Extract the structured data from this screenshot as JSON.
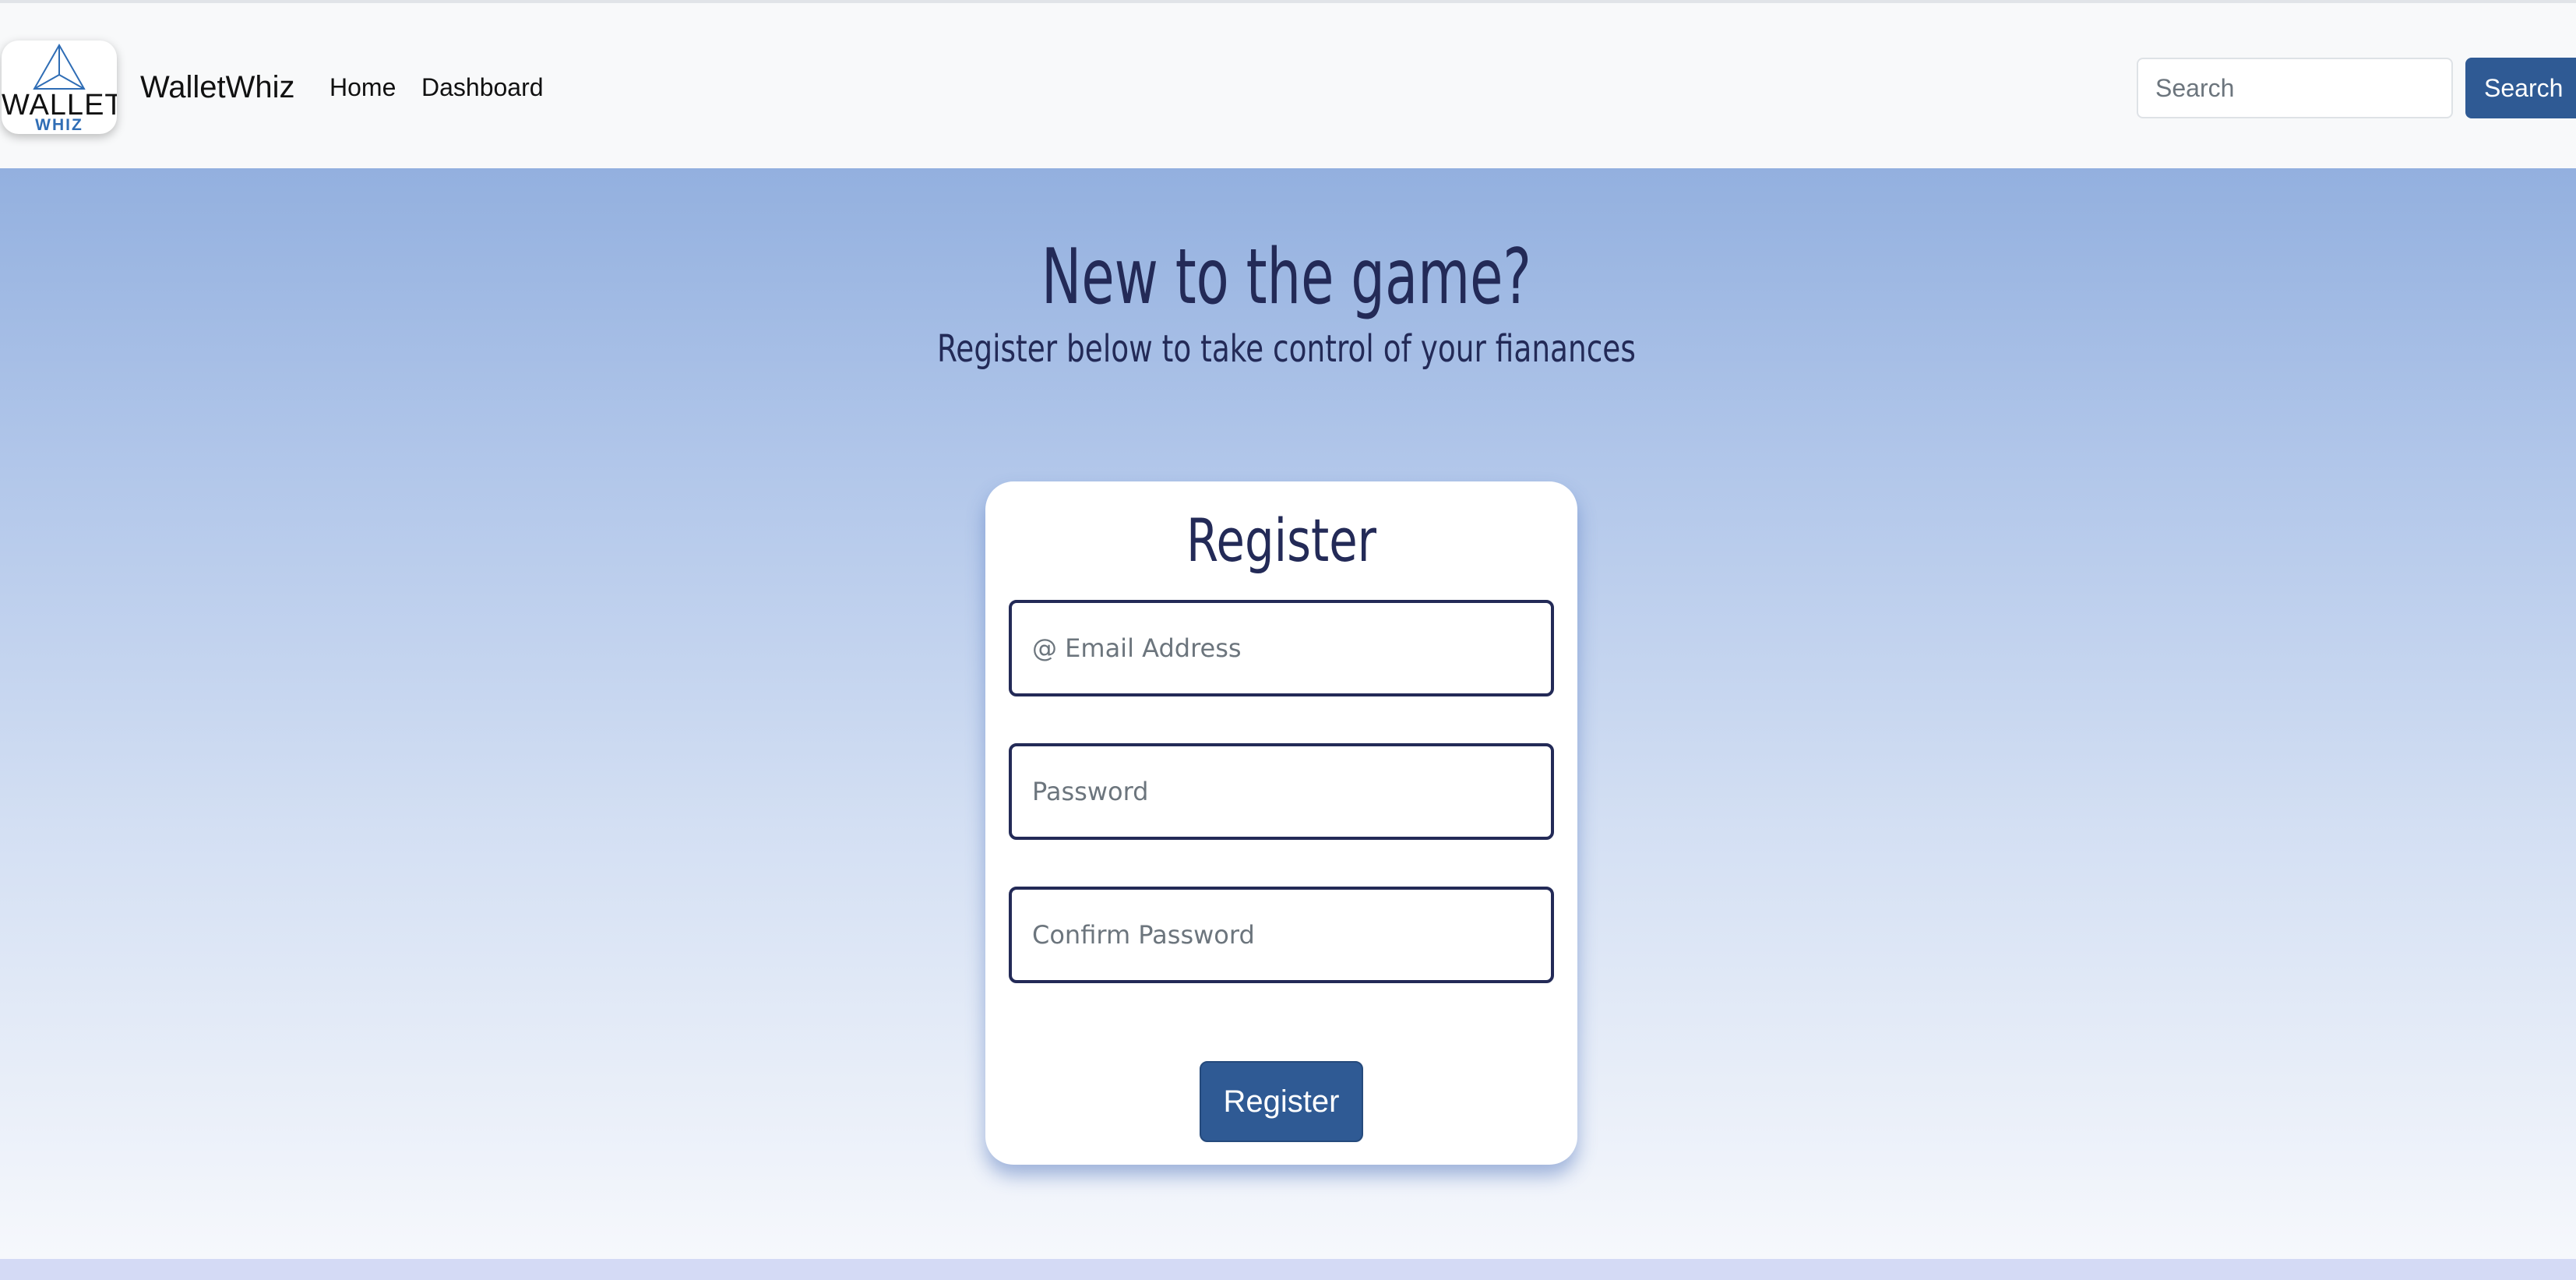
{
  "navbar": {
    "logo": {
      "word": "WALLET",
      "sub": "WHIZ"
    },
    "brand": "WalletWhiz",
    "links": [
      "Home",
      "Dashboard"
    ],
    "search": {
      "placeholder": "Search",
      "button_label": "Search"
    }
  },
  "hero": {
    "title": "New to the game?",
    "subtitle": "Register below to take control of your fianances"
  },
  "register_form": {
    "title": "Register",
    "email_placeholder": "@ Email Address",
    "password_placeholder": "Password",
    "confirm_placeholder": "Confirm Password",
    "submit_label": "Register"
  },
  "colors": {
    "primary": "#2f5a94",
    "heading": "#232a57",
    "hero_top": "#93b0df",
    "hero_bottom": "#f6f8fc"
  }
}
